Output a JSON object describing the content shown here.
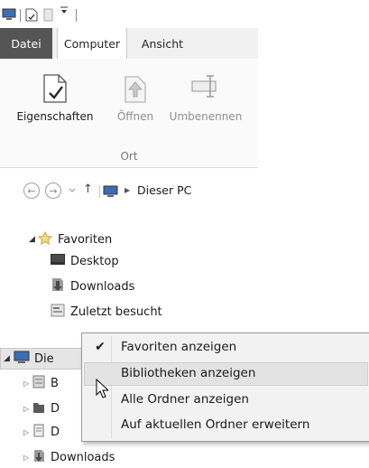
{
  "titlebar": {
    "icons": [
      "computer-icon",
      "properties-icon",
      "folder-icon",
      "quick-access-dropdown-icon"
    ]
  },
  "tabs": {
    "file": "Datei",
    "computer": "Computer",
    "view": "Ansicht"
  },
  "ribbon": {
    "buttons": [
      {
        "label": "Eigenschaften",
        "icon": "properties-icon",
        "enabled": true
      },
      {
        "label": "Öffnen",
        "icon": "open-icon",
        "enabled": false
      },
      {
        "label": "Umbenennen",
        "icon": "rename-icon",
        "enabled": false
      }
    ],
    "group_label": "Ort"
  },
  "address": {
    "back_icon": "back-arrow-icon",
    "forward_icon": "forward-arrow-icon",
    "recent_icon": "chevron-down-icon",
    "up_icon": "up-arrow-icon",
    "path": "Dieser PC"
  },
  "tree": {
    "favorites_label": "Favoriten",
    "favorites_items": [
      {
        "label": "Desktop",
        "icon": "desktop-icon"
      },
      {
        "label": "Downloads",
        "icon": "downloads-icon"
      },
      {
        "label": "Zuletzt besucht",
        "icon": "recent-places-icon"
      }
    ],
    "this_pc_label": "Die",
    "sub_items_prefix": [
      "B",
      "D",
      "D"
    ],
    "last_item": "Downloads"
  },
  "context_menu": {
    "items": [
      {
        "label": "Favoriten anzeigen",
        "checked": true
      },
      {
        "label": "Bibliotheken anzeigen",
        "checked": false,
        "hover": true
      },
      {
        "label": "Alle Ordner anzeigen",
        "checked": false
      },
      {
        "label": "Auf aktuellen Ordner erweitern",
        "checked": false
      }
    ],
    "check_glyph": "✔"
  },
  "colors": {
    "file_tab_bg": "#555555",
    "tab_strip_bg": "#f1f1f1",
    "menu_bg": "#f2f2f2",
    "menu_hover": "#e3e3e3",
    "star_gold": "#d9b441"
  }
}
